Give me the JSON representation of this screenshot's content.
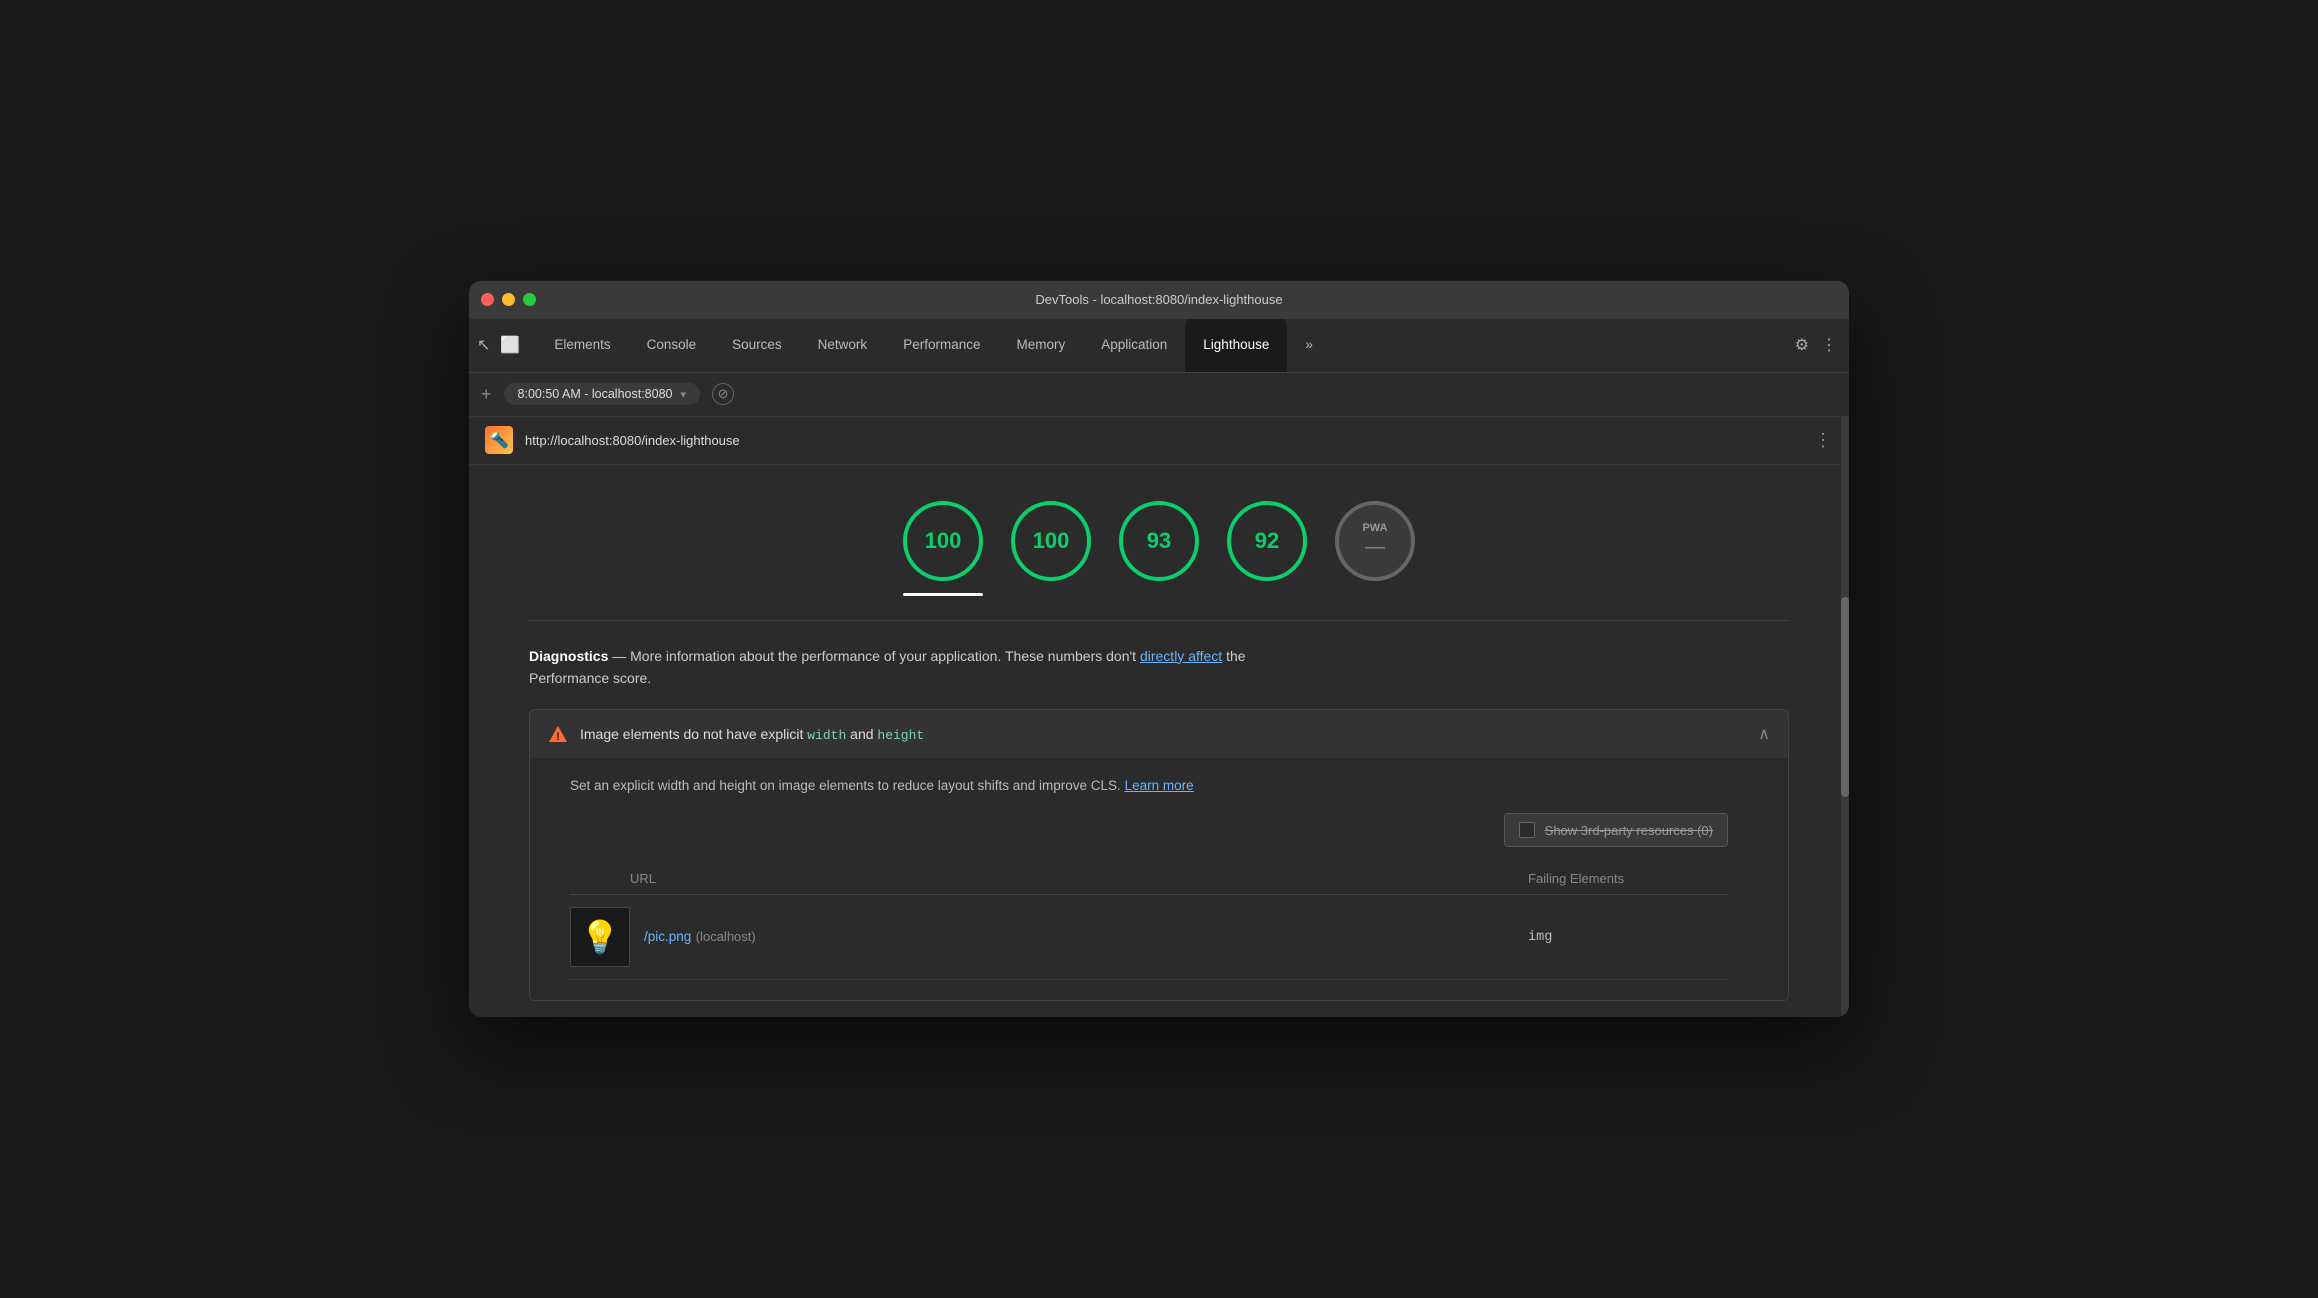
{
  "window": {
    "title": "DevTools - localhost:8080/index-lighthouse"
  },
  "tabs": {
    "elements": "Elements",
    "console": "Console",
    "sources": "Sources",
    "network": "Network",
    "performance": "Performance",
    "memory": "Memory",
    "application": "Application",
    "lighthouse": "Lighthouse",
    "more": "»"
  },
  "address_bar": {
    "url_display": "8:00:50 AM - localhost:8080",
    "plus_label": "+",
    "dropdown_arrow": "▾"
  },
  "lighthouse_url_bar": {
    "url": "http://localhost:8080/index-lighthouse",
    "more_icon": "⋮"
  },
  "scores": [
    {
      "value": "100",
      "type": "green",
      "selected": true
    },
    {
      "value": "100",
      "type": "green",
      "selected": false
    },
    {
      "value": "93",
      "type": "green",
      "selected": false
    },
    {
      "value": "92",
      "type": "green",
      "selected": false
    },
    {
      "value": "PWA",
      "type": "pwa",
      "selected": false
    }
  ],
  "diagnostics": {
    "label": "Diagnostics",
    "description_before": "— More information about the performance of your application. These numbers don't ",
    "link_text": "directly affect",
    "description_after": " the",
    "description_line2": "Performance score."
  },
  "audit": {
    "title_before": "Image elements do not have explicit ",
    "code1": "width",
    "title_mid": " and ",
    "code2": "height",
    "description": "Set an explicit width and height on image elements to reduce layout shifts and improve CLS. ",
    "learn_more": "Learn more",
    "third_party_label": "Show 3rd-party resources (0)",
    "table_col_url": "URL",
    "table_col_failing": "Failing Elements",
    "row_url": "/pic.png",
    "row_host": "(localhost)",
    "row_failing": "img"
  },
  "icons": {
    "settings": "⚙",
    "more_vert": "⋮",
    "cursor": "↖",
    "mobile": "📱",
    "stop": "⊘"
  },
  "colors": {
    "green_score": "#0cce6b",
    "tab_active_bg": "#1a1a1a",
    "warning_orange": "#ff6b35",
    "link_blue": "#6ab4ff",
    "code_teal": "#7fd4b3"
  }
}
